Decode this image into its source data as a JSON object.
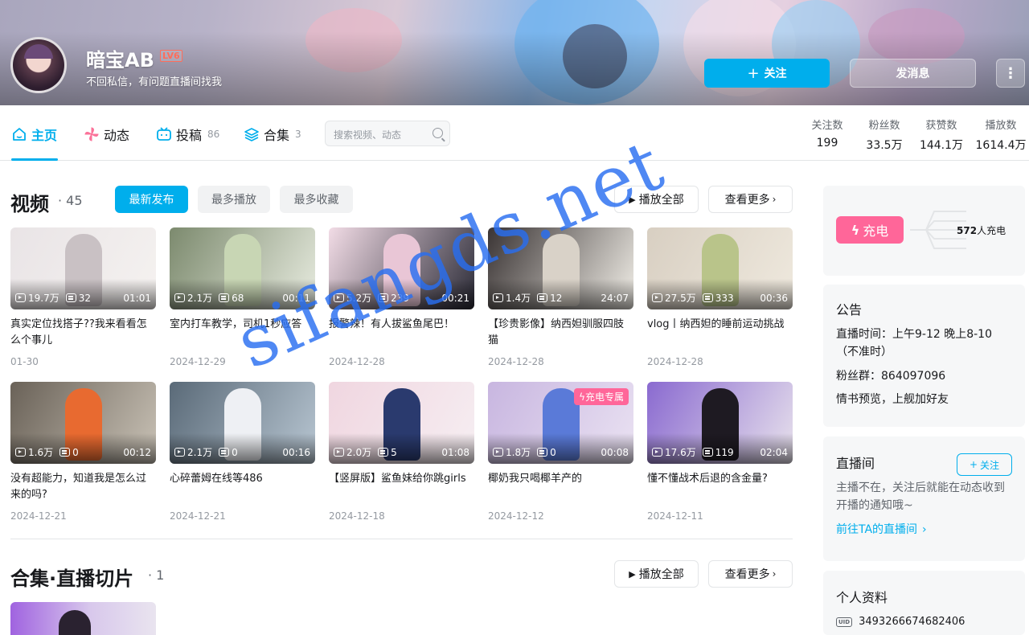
{
  "profile": {
    "name": "暗宝AB",
    "level": "LV6",
    "signature": "不回私信，有问题直播间找我",
    "follow_label": "关注",
    "message_label": "发消息",
    "more_label": "⋮"
  },
  "nav": {
    "tabs": [
      {
        "label": "主页",
        "count": ""
      },
      {
        "label": "动态",
        "count": ""
      },
      {
        "label": "投稿",
        "count": "86"
      },
      {
        "label": "合集",
        "count": "3"
      }
    ],
    "search_placeholder": "搜索视频、动态"
  },
  "stats": [
    {
      "label": "关注数",
      "value": "199"
    },
    {
      "label": "粉丝数",
      "value": "33.5万"
    },
    {
      "label": "获赞数",
      "value": "144.1万"
    },
    {
      "label": "播放数",
      "value": "1614.4万"
    }
  ],
  "videos_section": {
    "title": "视频",
    "count": "45",
    "filters": [
      "最新发布",
      "最多播放",
      "最多收藏"
    ],
    "play_all": "播放全部",
    "see_more": "查看更多",
    "items": [
      {
        "plays": "19.7万",
        "danmaku": "32",
        "duration": "01:01",
        "title": "真实定位找搭子??我来看看怎么个事儿",
        "date": "01-30",
        "tag": ""
      },
      {
        "plays": "2.1万",
        "danmaku": "68",
        "duration": "00:11",
        "title": "室内打车教学，司机1秒应答",
        "date": "2024-12-29",
        "tag": ""
      },
      {
        "plays": "5.2万",
        "danmaku": "239",
        "duration": "00:21",
        "title": "报警辣！有人拔鲨鱼尾巴！",
        "date": "2024-12-28",
        "tag": ""
      },
      {
        "plays": "1.4万",
        "danmaku": "12",
        "duration": "24:07",
        "title": "【珍贵影像】纳西妲驯服四肢猫",
        "date": "2024-12-28",
        "tag": ""
      },
      {
        "plays": "27.5万",
        "danmaku": "333",
        "duration": "00:36",
        "title": "vlog丨纳西妲的睡前运动挑战",
        "date": "2024-12-28",
        "tag": ""
      },
      {
        "plays": "1.6万",
        "danmaku": "0",
        "duration": "00:12",
        "title": "没有超能力，知道我是怎么过来的吗?",
        "date": "2024-12-21",
        "tag": ""
      },
      {
        "plays": "2.1万",
        "danmaku": "0",
        "duration": "00:16",
        "title": "心碎蕾姆在线等486",
        "date": "2024-12-21",
        "tag": ""
      },
      {
        "plays": "2.0万",
        "danmaku": "5",
        "duration": "01:08",
        "title": "【竖屏版】鲨鱼妹给你跳girls",
        "date": "2024-12-18",
        "tag": ""
      },
      {
        "plays": "1.8万",
        "danmaku": "0",
        "duration": "00:08",
        "title": "椰奶我只喝椰羊产的",
        "date": "2024-12-12",
        "tag": "充电专属"
      },
      {
        "plays": "17.6万",
        "danmaku": "119",
        "duration": "02:04",
        "title": "懂不懂战术后退的含金量?",
        "date": "2024-12-11",
        "tag": ""
      }
    ]
  },
  "collections_section": {
    "title": "合集·直播切片",
    "count": "1",
    "play_all": "播放全部",
    "see_more": "查看更多"
  },
  "sidebar": {
    "charge": {
      "button": "充电",
      "count": "572",
      "suffix": "人充电"
    },
    "notice": {
      "title": "公告",
      "lines": [
        "直播时间：上午9-12 晚上8-10（不准时）",
        "粉丝群：864097096",
        "情书预览，上舰加好友"
      ]
    },
    "live": {
      "title": "直播间",
      "follow": "关注",
      "text": "主播不在，关注后就能在动态收到开播的通知哦~",
      "link": "前往TA的直播间"
    },
    "info": {
      "title": "个人资料",
      "uid_label": "UID",
      "uid": "3493266674682406"
    }
  },
  "watermark": "sifangds.net",
  "colors": {
    "accent": "#00aeec",
    "charge": "#ff6699",
    "level": "#ff6d5a"
  }
}
